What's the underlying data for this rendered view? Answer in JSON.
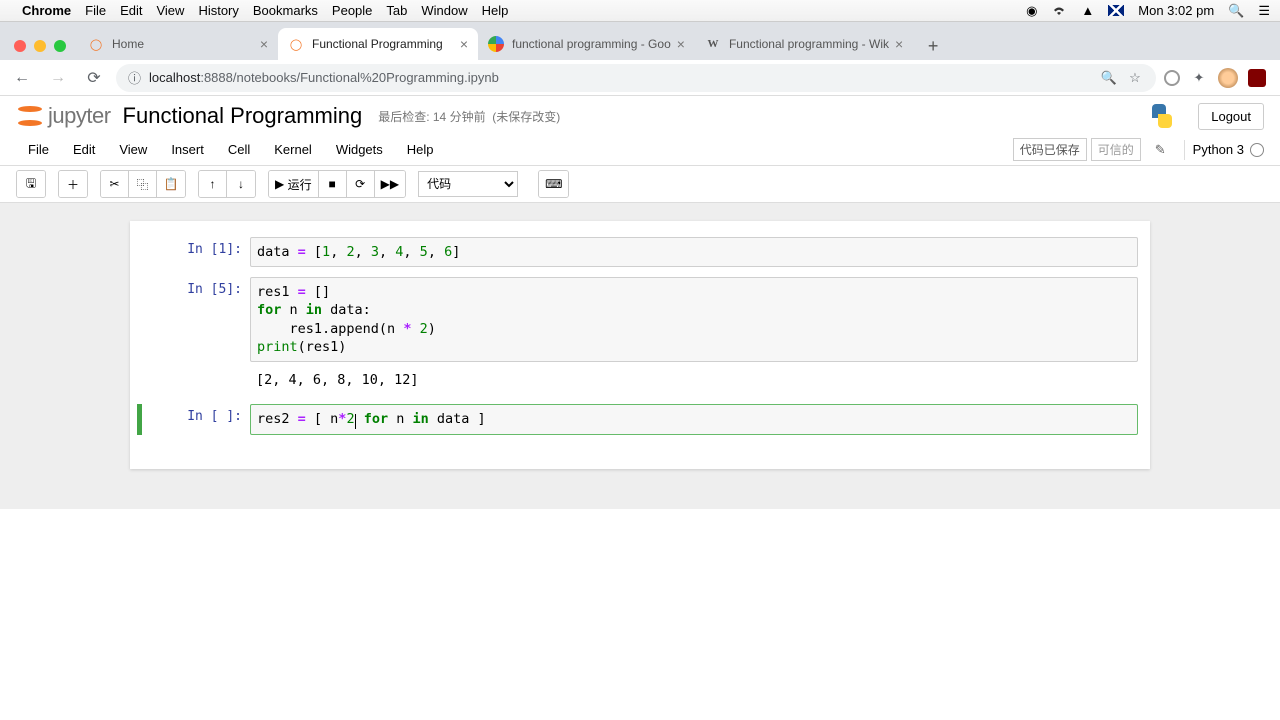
{
  "menubar": {
    "app": "Chrome",
    "items": [
      "File",
      "Edit",
      "View",
      "History",
      "Bookmarks",
      "People",
      "Tab",
      "Window",
      "Help"
    ],
    "clock": "Mon 3:02 pm"
  },
  "browser": {
    "tabs": [
      {
        "title": "Home",
        "favicon": "jupyter",
        "active": false
      },
      {
        "title": "Functional Programming",
        "favicon": "jupyter",
        "active": true
      },
      {
        "title": "functional programming - Goo",
        "favicon": "google",
        "active": false
      },
      {
        "title": "Functional programming - Wik",
        "favicon": "wiki",
        "active": false
      }
    ],
    "url_host": "localhost",
    "url_port": ":8888",
    "url_path": "/notebooks/Functional%20Programming.ipynb"
  },
  "jupyter": {
    "logo_text": "jupyter",
    "title": "Functional Programming",
    "checkpoint": "最后检查: 14 分钟前",
    "unsaved": "(未保存改变)",
    "logout": "Logout",
    "menus": [
      "File",
      "Edit",
      "View",
      "Insert",
      "Cell",
      "Kernel",
      "Widgets",
      "Help"
    ],
    "saved_status": "代码已保存",
    "trusted": "可信的",
    "kernel": "Python 3",
    "toolbar": {
      "run_label": "运行",
      "celltype": "代码"
    }
  },
  "cells": [
    {
      "prompt": "In [1]:",
      "code_html": "data <span class='op'>=</span> [<span class='num'>1</span>, <span class='num'>2</span>, <span class='num'>3</span>, <span class='num'>4</span>, <span class='num'>5</span>, <span class='num'>6</span>]"
    },
    {
      "prompt": "In [5]:",
      "code_html": "res1 <span class='op'>=</span> []\n<span class='kw'>for</span> n <span class='kw'>in</span> data:\n    res1.append(n <span class='op'>*</span> <span class='num'>2</span>)\n<span class='bn'>print</span>(res1)",
      "output": "[2, 4, 6, 8, 10, 12]"
    },
    {
      "prompt": "In [ ]:",
      "selected": true,
      "code_html": "res2 <span class='op'>=</span> [ n<span class='op'>*</span><span class='num'>2</span><span class='cursor'></span> <span class='kw'>for</span> n <span class='kw'>in</span> data ]"
    }
  ]
}
